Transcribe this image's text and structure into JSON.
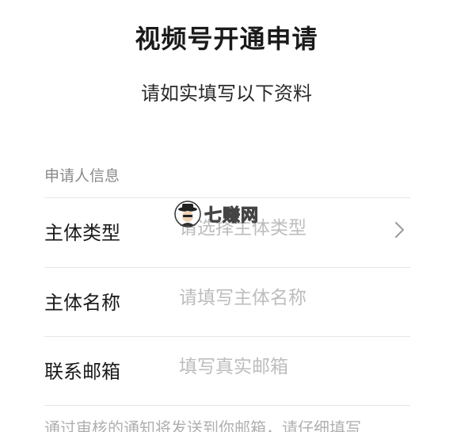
{
  "header": {
    "title": "视频号开通申请",
    "subtitle": "请如实填写以下资料"
  },
  "form": {
    "section_label": "申请人信息",
    "fields": [
      {
        "label": "主体类型",
        "placeholder": "请选择主体类型",
        "value": "",
        "icon": "chevron-right-icon"
      },
      {
        "label": "主体名称",
        "placeholder": "请填写主体名称",
        "value": ""
      },
      {
        "label": "联系邮箱",
        "placeholder": "填写真实邮箱",
        "value": ""
      }
    ],
    "footer_note": "通过审核的通知将发送到你邮箱，请仔细填写"
  },
  "watermark": {
    "text": "七赚网"
  },
  "colors": {
    "text_primary": "#1a1a1a",
    "text_secondary": "#8a8a8a",
    "placeholder": "#bdbdbd",
    "divider": "#e6e6e6",
    "background": "#ffffff"
  }
}
